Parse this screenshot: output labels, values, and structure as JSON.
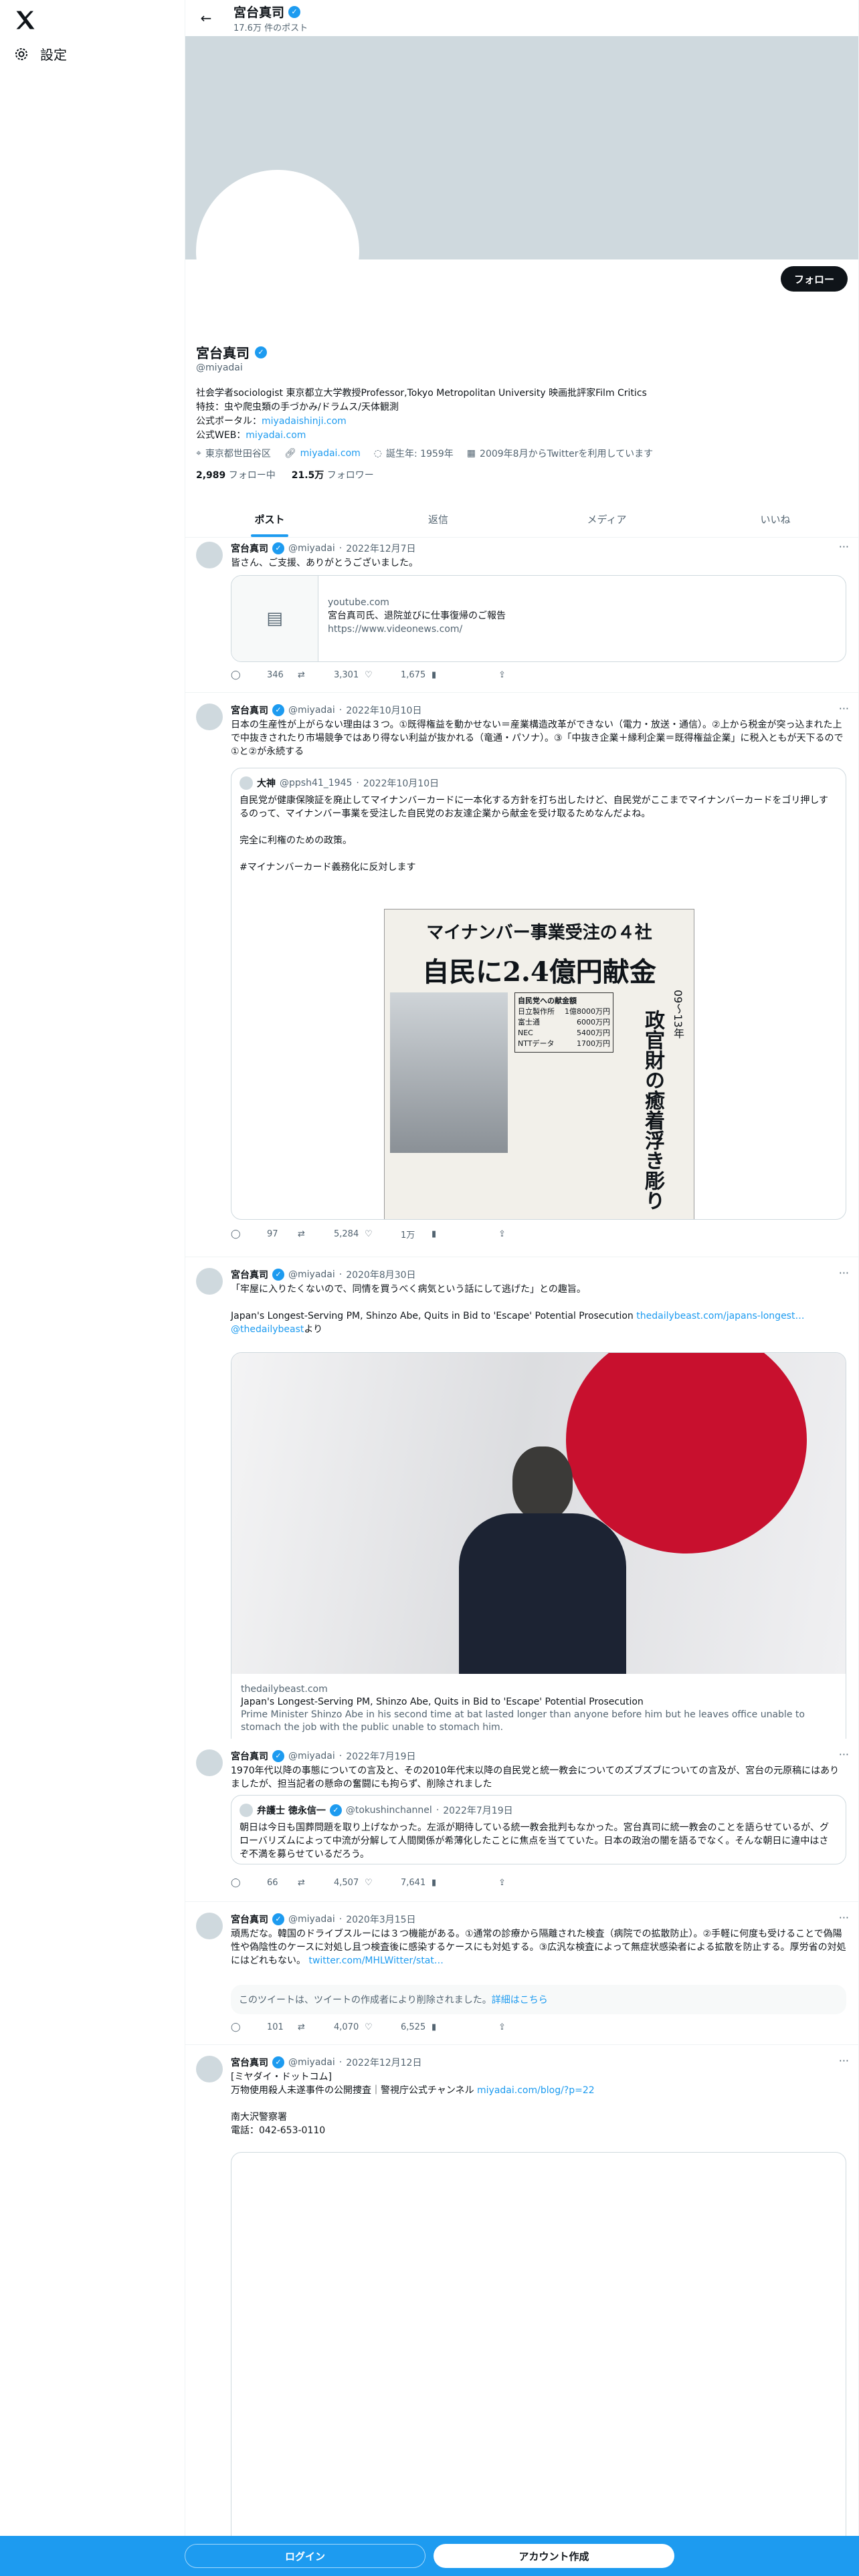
{
  "nav": {
    "settings_label": "設定"
  },
  "header": {
    "name": "宮台真司",
    "post_count": "17.6万 件のポスト"
  },
  "profile": {
    "follow_label": "フォロー",
    "name": "宮台真司",
    "handle": "@miyadai",
    "bio_1": "社会学者sociologist 東京都立大学教授Professor,Tokyo Metropolitan University 映画批評家Film Critics",
    "bio_2": "特技：虫や爬虫類の手づかみ/ドラムス/天体観測",
    "bio_3_label": "公式ポータル：",
    "bio_3_link": "miyadaishinji.com",
    "bio_4_label": "公式WEB：",
    "bio_4_link": "miyadai.com",
    "location": "東京都世田谷区",
    "website": "miyadai.com",
    "birthday": "誕生年: 1959年",
    "joined": "2009年8月からTwitterを利用しています",
    "following_count": "2,989",
    "following_label": "フォロー中",
    "followers_count": "21.5万",
    "followers_label": "フォロワー"
  },
  "tabs": [
    "ポスト",
    "返信",
    "メディア",
    "いいね"
  ],
  "tweets": [
    {
      "name": "宮台真司",
      "handle": "@miyadai",
      "date": "2022年12月7日",
      "text": "皆さん、ご支援、ありがとうございました。",
      "card_domain": "youtube.com",
      "card_title": "宮台真司氏、退院並びに仕事復帰のご報告",
      "card_url": "https://www.videonews.com/",
      "replies": "346",
      "retweets": "3,301",
      "likes": "1,675"
    },
    {
      "name": "宮台真司",
      "handle": "@miyadai",
      "date": "2022年10月10日",
      "text": "日本の生産性が上がらない理由は３つ。①既得権益を動かせない＝産業構造改革ができない（電力・放送・通信）。②上から税金が突っ込まれた上で中抜きされたり市場競争ではあり得ない利益が抜かれる（竜通・パソナ）。③「中抜き企業＋縁利企業＝既得権益企業」に税入ともが天下るので①と②が永続する",
      "q_name": "大神",
      "q_handle": "@ppsh41_1945",
      "q_date": "2022年10月10日",
      "q_text": "自民党が健康保険証を廃止してマイナンバーカードに一本化する方針を打ち出したけど、自民党がここまでマイナンバーカードをゴリ押しするのって、マイナンバー事業を受注した自民党のお友達企業から献金を受け取るためなんだよね。\n\n完全に利権のための政策。\n\n#マイナンバーカード義務化に反対します",
      "np_head": "マイナンバー事業受注の４社",
      "np_title": "自民に2.4億円献金",
      "np_side": "政官財の癒着浮き彫り",
      "np_years": "09〜13年",
      "np_table_title": "自民党への献金額",
      "np_rows": [
        [
          "日立製作所",
          "1億8000万円"
        ],
        [
          "富士通",
          "6000万円"
        ],
        [
          "NEC",
          "5400万円"
        ],
        [
          "NTTデータ",
          "1700万円"
        ]
      ],
      "replies": "97",
      "retweets": "5,284",
      "likes": "1万"
    },
    {
      "name": "宮台真司",
      "handle": "@miyadai",
      "date": "2020年8月30日",
      "text": "「牢屋に入りたくないので、同情を買うべく病気という話にして逃げた」との趣旨。",
      "text2": "Japan's Longest-Serving PM, Shinzo Abe, Quits in Bid to 'Escape' Potential Prosecution ",
      "link": "thedailybeast.com/japans-longest…",
      "link2": "@thedailybeast",
      "link2_suffix": "より",
      "card_domain": "thedailybeast.com",
      "card_title": "Japan's Longest-Serving PM, Shinzo Abe, Quits in Bid to 'Escape' Potential Prosecution",
      "card_desc": "Prime Minister Shinzo Abe in his second time at bat lasted longer than anyone before him but he leaves office unable to stomach the job with the public unable to stomach him."
    },
    {
      "name": "宮台真司",
      "handle": "@miyadai",
      "date": "2022年7月19日",
      "text": "1970年代以降の事態についての言及と、その2010年代末以降の自民党と統一教会についてのズブズブについての言及が、宮台の元原稿にはありましたが、担当記者の懸命の奮闘にも拘らず、削除されました",
      "q_name": "弁護士 徳永信一",
      "q_handle": "@tokushinchannel",
      "q_date": "2022年7月19日",
      "q_text": "朝日は今日も国葬問題を取り上げなかった。左派が期待している統一教会批判もなかった。宮台真司に統一教会のことを語らせているが、グローバリズムによって中流が分解して人間関係が希薄化したことに焦点を当てていた。日本の政治の闇を語るでなく。そんな朝日に違中はさぞ不満を募らせているだろう。",
      "replies": "66",
      "retweets": "4,507",
      "likes": "7,641"
    },
    {
      "name": "宮台真司",
      "handle": "@miyadai",
      "date": "2020年3月15日",
      "text": "頑馬だな。韓国のドライブスルーには３つ機能がある。①通常の診療から隔離された検査（病院での拡散防止）。②手軽に何度も受けることで偽陽性や偽陰性のケースに対処し且つ検査後に感染するケースにも対処する。③広汎な検査によって無症状感染者による拡散を防止する。厚労省の対処にはどれもない。",
      "link": "twitter.com/MHLWitter/stat…",
      "deleted": "このツイートは、ツイートの作成者により削除されました。",
      "deleted_link": "詳細はこちら",
      "replies": "101",
      "retweets": "4,070",
      "likes": "6,525"
    },
    {
      "name": "宮台真司",
      "handle": "@miyadai",
      "date": "2022年12月12日",
      "text": "[ミヤダイ・ドットコム]\n万物使用殺人未遂事件の公開捜査｜警視庁公式チャンネル ",
      "link": "miyadai.com/blog/?p=22",
      "text2": "南大沢警察署\n電話：042-653-0110"
    }
  ],
  "footer": {
    "login": "ログイン",
    "signup": "アカウント作成"
  },
  "colors": {
    "accent": "#1d9bf0",
    "banner": "#cfd9de"
  }
}
